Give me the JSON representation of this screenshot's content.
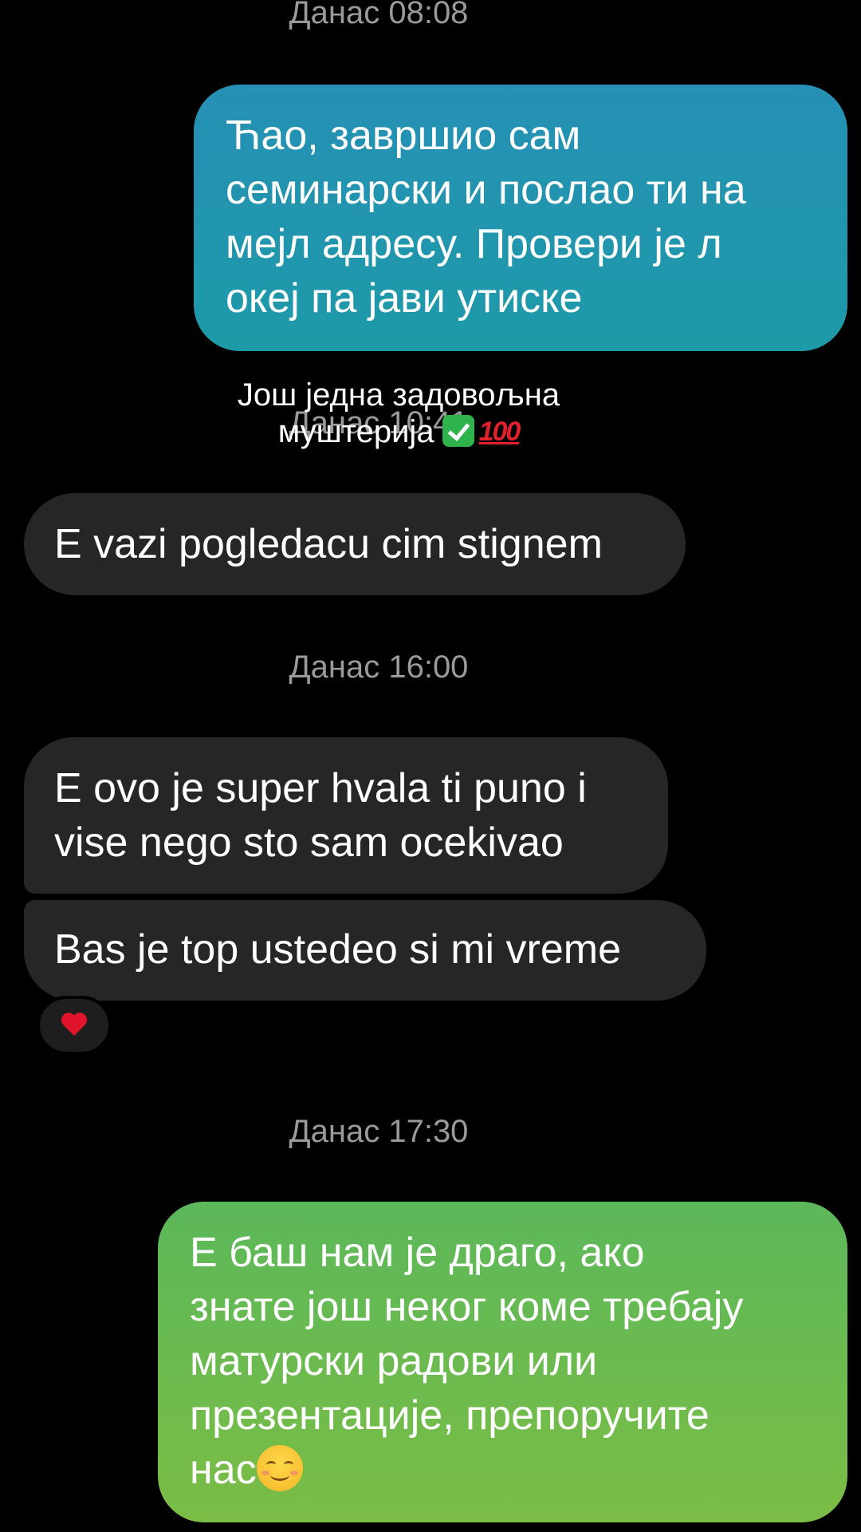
{
  "timestamps": [
    "Данас 08:08",
    "Данас 10:41",
    "Данас 16:00",
    "Данас 17:30"
  ],
  "overlay": {
    "line1": "Још једна задовољна",
    "line2": "муштерија",
    "icons": [
      "check-mark-icon",
      "hundred-points-icon"
    ]
  },
  "messages": [
    {
      "direction": "sent",
      "lines": [
        "Ћао, завршио сам",
        "семинарски и послао ти на",
        "мејл адресу. Провери је л",
        "океј па јави утиске"
      ]
    },
    {
      "direction": "received",
      "lines": [
        "E vazi pogledacu cim stignem"
      ]
    },
    {
      "direction": "received",
      "lines": [
        "E ovo je super hvala ti puno i",
        "vise nego sto sam ocekivao"
      ]
    },
    {
      "direction": "received",
      "lines": [
        "Bas je top ustedeo si mi vreme"
      ],
      "reaction": "heart-icon"
    },
    {
      "direction": "sent",
      "lines": [
        "Е баш нам је драго, ако",
        "знате још неког коме требају",
        "матурски радови или",
        "презентације, препоручите",
        "нас"
      ],
      "trailing_icon": "smiling-face-icon"
    }
  ],
  "colors": {
    "background": "#000000",
    "sent_blue": "#2690b5",
    "sent_green": "#6cbb4f",
    "received": "#262626",
    "timestamp": "#9a9a9a"
  }
}
